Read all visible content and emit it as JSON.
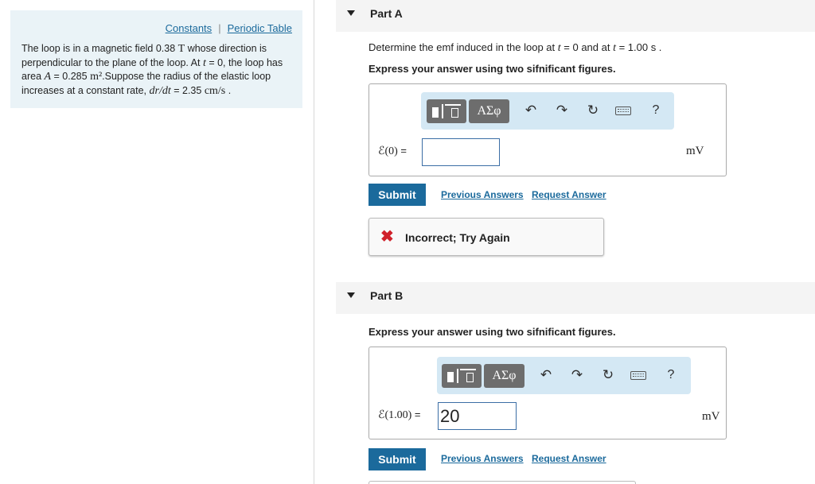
{
  "problem": {
    "links": {
      "constants": "Constants",
      "separator": "|",
      "periodic_table": "Periodic Table"
    },
    "text": {
      "s1": "The loop is in a magnetic field 0.38 ",
      "tesla": "T",
      "s2": " whose direction is perpendicular to the plane of the loop. At ",
      "t_var": "t",
      "s3": " = 0, the loop has area ",
      "a_var": "A",
      "s4": " = 0.285 ",
      "area_unit": "m²",
      "s5": ".Suppose the radius of the elastic loop increases at a constant rate, ",
      "drdt": "dr/dt",
      "s6": " = 2.35 ",
      "rate_unit": "cm/s",
      "s7": " ."
    }
  },
  "part_a": {
    "label": "Part A",
    "question": {
      "p1": "Determine the emf induced in the loop at ",
      "t1": "t",
      "p2": " = 0 and at ",
      "t2": "t",
      "p3": " = 1.00 s ."
    },
    "instruction": "Express your answer using two sifnificant figures.",
    "toolbar": {
      "greek": "ΑΣφ",
      "help": "?"
    },
    "eq_label": {
      "lhs": "ℰ(0)",
      "mid": " ="
    },
    "input_value": "",
    "unit": "mV",
    "submit": "Submit",
    "previous_answers": "Previous Answers",
    "request_answer": "Request Answer",
    "feedback": {
      "icon": "✖",
      "message": "Incorrect; Try Again"
    }
  },
  "part_b": {
    "label": "Part B",
    "instruction": "Express your answer using two sifnificant figures.",
    "toolbar": {
      "greek": "ΑΣφ",
      "help": "?"
    },
    "eq_label": {
      "lhs": "ℰ(1.00)",
      "mid": " ="
    },
    "input_value": "20",
    "unit": "mV",
    "submit": "Submit",
    "previous_answers": "Previous Answers",
    "request_answer": "Request Answer"
  },
  "colors": {
    "accent": "#1b6a9c",
    "panel": "#eaf3f7",
    "toolbar": "#d4e8f4",
    "error": "#d0202a"
  }
}
